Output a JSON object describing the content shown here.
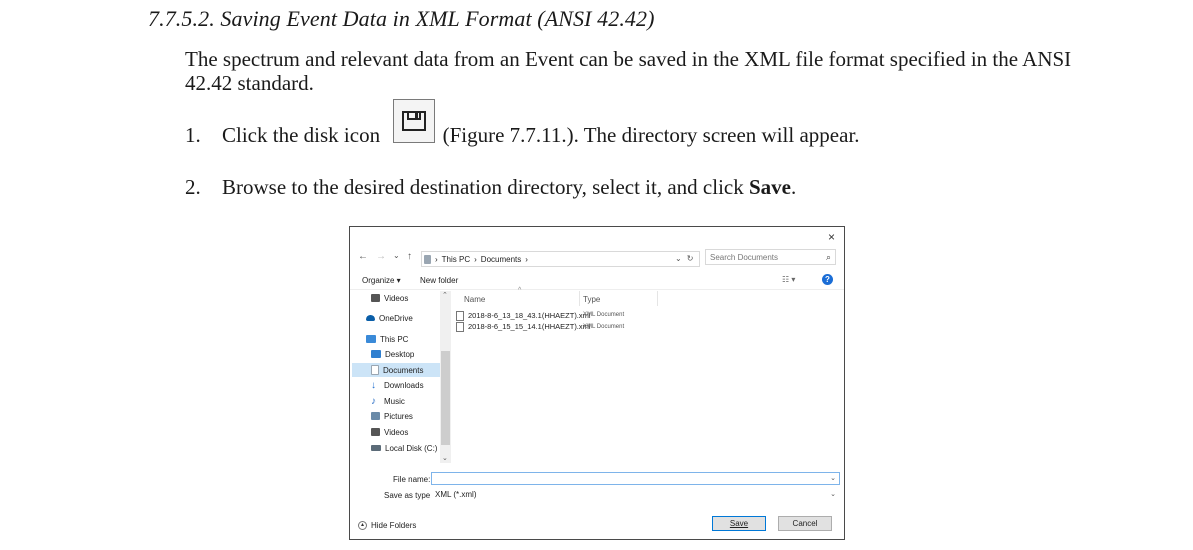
{
  "doc": {
    "heading": "7.7.5.2. Saving Event Data in XML Format (ANSI 42.42)",
    "intro": "The spectrum and relevant data from an Event can be saved in the XML file format specified in the ANSI 42.42 standard.",
    "step1": {
      "num": "1.",
      "before": "Click the disk icon",
      "after": "(Figure 7.7.11.). The directory screen will appear."
    },
    "step2": {
      "num": "2.",
      "before": "Browse to the desired destination directory, select it, and click ",
      "bold": "Save",
      "after": "."
    }
  },
  "dialog": {
    "close": "×",
    "nav": {
      "back": "←",
      "forward": "→",
      "dropdown": "⌄",
      "up": "↑"
    },
    "address": {
      "sep1": "›",
      "this_pc": "This PC",
      "sep2": "›",
      "documents": "Documents",
      "sep3": "›"
    },
    "refresh": "↻",
    "search_placeholder": "Search Documents",
    "organize": "Organize ▾",
    "new_folder": "New folder",
    "view_icon": "☷ ▾",
    "help": "?",
    "sidebar": [
      {
        "label": "Videos",
        "icon": "video-icon",
        "color": "#555555"
      },
      {
        "label": "OneDrive",
        "icon": "cloud-icon",
        "color": "#0a5ea8"
      },
      {
        "label": "This PC",
        "icon": "computer-icon",
        "color": "#3a8ad8"
      },
      {
        "label": "Desktop",
        "icon": "desktop-icon",
        "color": "#2f7fd0"
      },
      {
        "label": "Documents",
        "icon": "document-icon",
        "color": "#9aa6b2"
      },
      {
        "label": "Downloads",
        "icon": "download-icon",
        "color": "#1f6fcf"
      },
      {
        "label": "Music",
        "icon": "music-icon",
        "color": "#2b6fc6"
      },
      {
        "label": "Pictures",
        "icon": "pictures-icon",
        "color": "#6a8aa8"
      },
      {
        "label": "Videos",
        "icon": "video-icon",
        "color": "#555555"
      },
      {
        "label": "Local Disk (C:)",
        "icon": "disk-drive-icon",
        "color": "#5b6b78"
      }
    ],
    "columns": {
      "name": "Name",
      "type": "Type",
      "sort": "^"
    },
    "files": [
      {
        "name": "2018-8-6_13_18_43.1(HHAEZT).xml",
        "type": "XML Document"
      },
      {
        "name": "2018-8-6_15_15_14.1(HHAEZT).xml",
        "type": "XML Document"
      }
    ],
    "file_name_label": "File name:",
    "file_name_value": "",
    "save_type_label": "Save as type:",
    "save_type_value": "XML (*.xml)",
    "hide_folders": "Hide Folders",
    "save": "Save",
    "cancel": "Cancel"
  }
}
